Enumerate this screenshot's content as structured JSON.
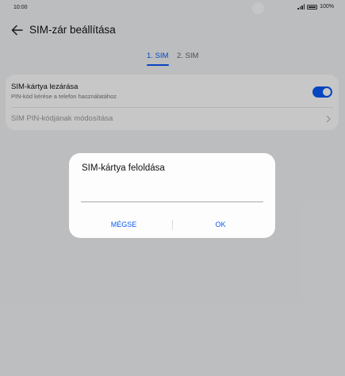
{
  "status_bar": {
    "time": "10:00",
    "battery_text": "100%",
    "icons": [
      "signal-icon",
      "battery-icon"
    ]
  },
  "header": {
    "title": "SIM-zár beállítása",
    "back_icon": "arrow-left-icon"
  },
  "tabs": [
    {
      "label": "1. SIM",
      "active": true
    },
    {
      "label": "2. SIM",
      "active": false
    }
  ],
  "settings": {
    "lock": {
      "title": "SIM-kártya lezárása",
      "subtitle": "PIN-kód kérése a telefon használatához",
      "toggle_on": true
    },
    "change_pin": {
      "title": "SIM PIN-kódjának módosítása",
      "icon": "chevron-right-icon"
    }
  },
  "dialog": {
    "title": "SIM-kártya feloldása",
    "input_value": "",
    "cancel_label": "MÉGSE",
    "ok_label": "OK"
  },
  "colors": {
    "accent": "#0a59f7",
    "background": "#f1f3f5",
    "card": "#ffffff",
    "scrim": "rgba(0,0,0,0.22)"
  }
}
